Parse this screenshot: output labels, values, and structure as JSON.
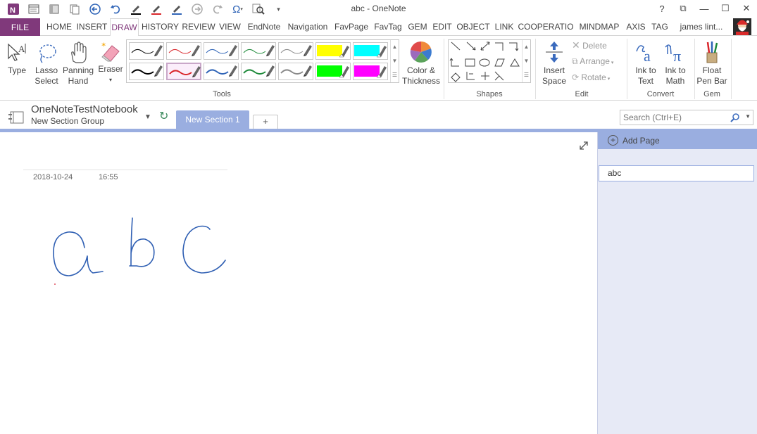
{
  "window": {
    "title": "abc - OneNote",
    "controls": [
      "?",
      "⧉",
      "—",
      "☐",
      "✕"
    ]
  },
  "tabs": {
    "file": "FILE",
    "items": [
      "HOME",
      "INSERT",
      "DRAW",
      "HISTORY",
      "REVIEW",
      "VIEW",
      "EndNote",
      "Navigation",
      "FavPage",
      "FavTag",
      "GEM",
      "EDIT",
      "OBJECT",
      "LINK",
      "COOPERATIO",
      "MINDMAP",
      "AXIS",
      "TAG"
    ],
    "active": "DRAW",
    "user": "james lint..."
  },
  "ribbon": {
    "type": "Type",
    "lasso_1": "Lasso",
    "lasso_2": "Select",
    "panning_1": "Panning",
    "panning_2": "Hand",
    "eraser": "Eraser",
    "tools_label": "Tools",
    "color_1": "Color &",
    "color_2": "Thickness",
    "shapes_label": "Shapes",
    "insert_space_1": "Insert",
    "insert_space_2": "Space",
    "delete": "Delete",
    "arrange": "Arrange",
    "rotate": "Rotate",
    "edit_label": "Edit",
    "ink_text_1": "Ink to",
    "ink_text_2": "Text",
    "ink_math_1": "Ink to",
    "ink_math_2": "Math",
    "convert_label": "Convert",
    "float_1": "Float",
    "float_2": "Pen Bar",
    "gem_label": "Gem",
    "pen_colors": [
      "#000000",
      "#d9262b",
      "#2f64b7",
      "#1e8a3a",
      "#8a8a8a",
      "#ffff00",
      "#00ffff",
      "#000000",
      "#d9262b",
      "#2f64b7",
      "#1e8a3a",
      "#8a8a8a",
      "#00ff00",
      "#ff00ff"
    ]
  },
  "notebook": {
    "name": "OneNoteTestNotebook",
    "group": "New Section Group",
    "section": "New Section 1",
    "add_section": "+",
    "search_placeholder": "Search (Ctrl+E)"
  },
  "page": {
    "date": "2018-10-24",
    "time": "16:55",
    "ink_color": "#2f5fb3"
  },
  "pagelist": {
    "add_page": "Add Page",
    "pages": [
      "abc"
    ]
  }
}
